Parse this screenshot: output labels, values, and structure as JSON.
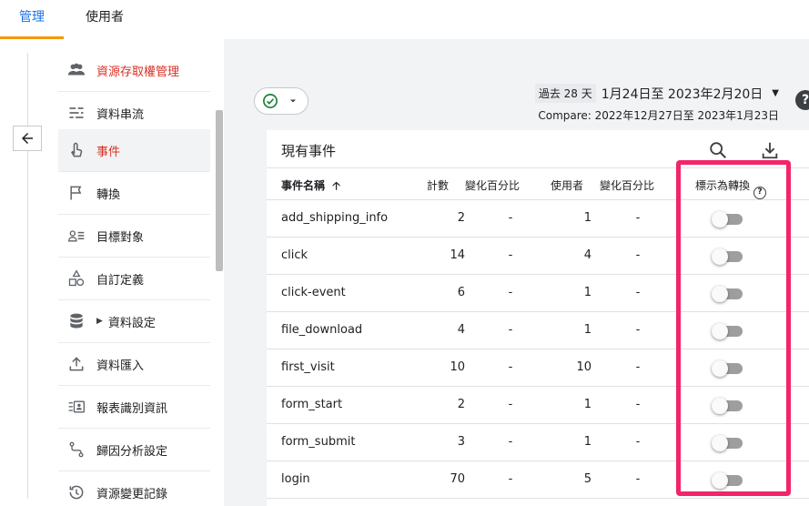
{
  "tabs": [
    {
      "label": "管理",
      "active": true
    },
    {
      "label": "使用者",
      "active": false
    }
  ],
  "sidebar": {
    "items": [
      {
        "label": "資源存取權管理",
        "icon": "people-icon",
        "active": false
      },
      {
        "label": "資料串流",
        "icon": "streams-icon",
        "active": false
      },
      {
        "label": "事件",
        "icon": "touch-icon",
        "active": true
      },
      {
        "label": "轉換",
        "icon": "flag-icon",
        "active": false
      },
      {
        "label": "目標對象",
        "icon": "audience-icon",
        "active": false
      },
      {
        "label": "自訂定義",
        "icon": "shapes-icon",
        "active": false
      },
      {
        "label": "資料設定",
        "icon": "database-icon",
        "active": false,
        "expandable": true
      },
      {
        "label": "資料匯入",
        "icon": "upload-icon",
        "active": false
      },
      {
        "label": "報表識別資訊",
        "icon": "identity-icon",
        "active": false
      },
      {
        "label": "歸因分析設定",
        "icon": "attribution-icon",
        "active": false
      },
      {
        "label": "資源變更記錄",
        "icon": "history-icon",
        "active": false
      }
    ]
  },
  "date": {
    "badge": "過去 28 天",
    "range": "1月24日至 2023年2月20日",
    "compare": "Compare: 2022年12月27日至 2023年1月23日"
  },
  "card": {
    "title": "現有事件",
    "columns": {
      "name": "事件名稱",
      "count": "計數",
      "count_change": "變化百分比",
      "users": "使用者",
      "users_change": "變化百分比",
      "conversion": "標示為轉換"
    },
    "rows": [
      {
        "name": "add_shipping_info",
        "count": "2",
        "count_change": "-",
        "users": "1",
        "users_change": "-"
      },
      {
        "name": "click",
        "count": "14",
        "count_change": "-",
        "users": "4",
        "users_change": "-"
      },
      {
        "name": "click-event",
        "count": "6",
        "count_change": "-",
        "users": "1",
        "users_change": "-"
      },
      {
        "name": "file_download",
        "count": "4",
        "count_change": "-",
        "users": "1",
        "users_change": "-"
      },
      {
        "name": "first_visit",
        "count": "10",
        "count_change": "-",
        "users": "10",
        "users_change": "-"
      },
      {
        "name": "form_start",
        "count": "2",
        "count_change": "-",
        "users": "1",
        "users_change": "-"
      },
      {
        "name": "form_submit",
        "count": "3",
        "count_change": "-",
        "users": "1",
        "users_change": "-"
      },
      {
        "name": "login",
        "count": "70",
        "count_change": "-",
        "users": "5",
        "users_change": "-"
      }
    ]
  },
  "colors": {
    "accent": "#1a73e8",
    "active_nav": "#d93025",
    "highlight": "#f2246c",
    "tab_underline": "#f29900"
  }
}
